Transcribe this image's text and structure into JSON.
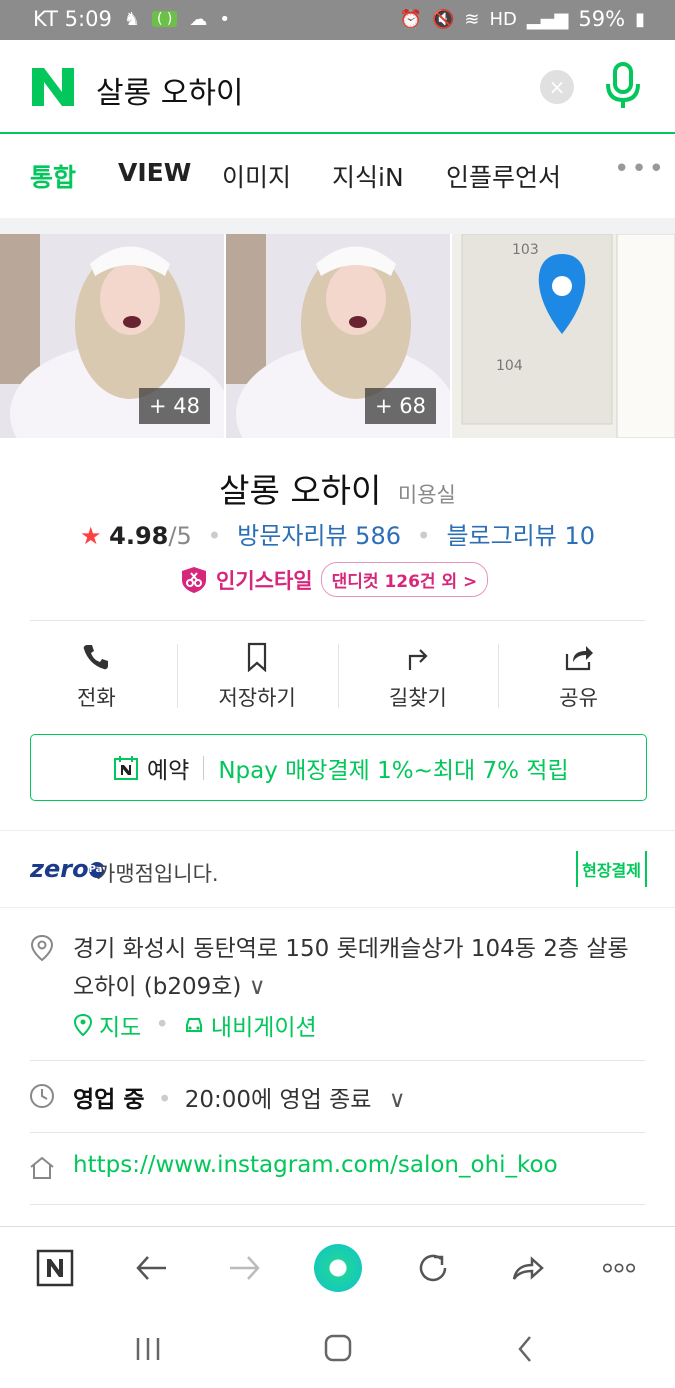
{
  "status_bar": {
    "carrier_time": "KT 5:09",
    "battery": "59%"
  },
  "search": {
    "query": "살롱 오하이",
    "clear_label": "×"
  },
  "tabs": [
    {
      "label": "통합",
      "active": true
    },
    {
      "label": "VIEW"
    },
    {
      "label": "이미지"
    },
    {
      "label": "지식iN"
    },
    {
      "label": "인플루언서"
    }
  ],
  "tabs_more": "•••",
  "photos": {
    "count1": "+ 48",
    "count2": "+ 68"
  },
  "map": {
    "label_103": "103",
    "label_104": "104"
  },
  "place": {
    "name": "살롱 오하이",
    "category": "미용실",
    "star": "★",
    "score": "4.98",
    "score_max": "/5",
    "visitor_reviews": "방문자리뷰 586",
    "blog_reviews": "블로그리뷰 10",
    "popular_label": "인기스타일",
    "popular_pill": "댄디컷 126건 외 >"
  },
  "actions": {
    "call": "전화",
    "save": "저장하기",
    "directions": "길찾기",
    "share": "공유"
  },
  "reservation": {
    "label": "예약",
    "npay": "Npay 매장결제 1%~최대 7% 적립"
  },
  "zeropay": {
    "logo": "zero",
    "logo_pay": "Pay",
    "text": "가맹점입니다.",
    "onsite": "현장결제"
  },
  "address": {
    "text": "경기 화성시 동탄역로 150 롯데캐슬상가 104동 2층 살롱 오하이 (b209호)",
    "map_link": "지도",
    "navi_link": "내비게이션"
  },
  "hours": {
    "status": "영업 중",
    "detail": "20:00에 영업 종료"
  },
  "website": {
    "url": "https://www.instagram.com/salon_ohi_koo"
  },
  "colors": {
    "naver_green": "#03c75a",
    "review_blue": "#2c6fb7",
    "style_pink": "#d6277c",
    "star_red": "#ff4040"
  }
}
